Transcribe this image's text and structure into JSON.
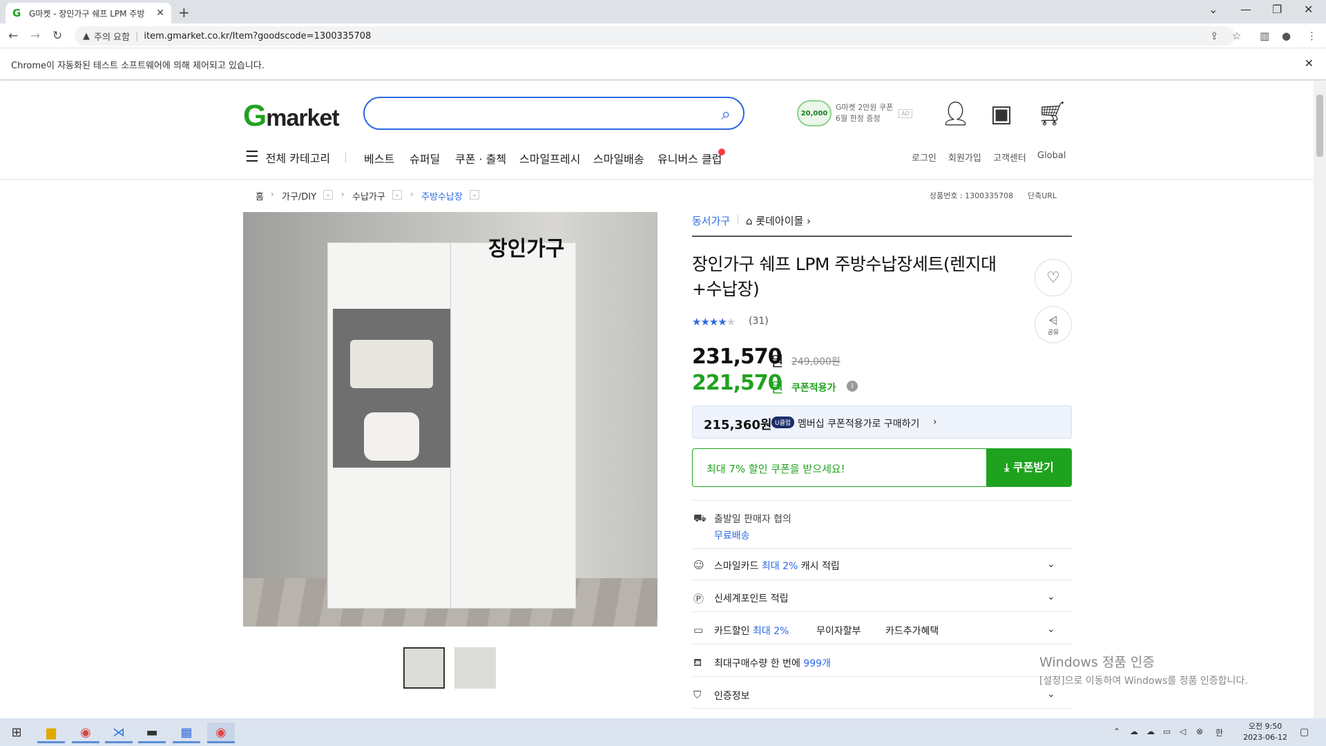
{
  "browser": {
    "tab_title": "G마켓 - 장인가구 쉐프 LPM 주방",
    "tab_favicon": "G",
    "new_tab": "+",
    "security_label": "주의 요함",
    "url": "item.gmarket.co.kr/Item?goodscode=1300335708",
    "infobar_text": "Chrome이 자동화된 테스트 소프트웨어에 의해 제어되고 있습니다."
  },
  "header": {
    "logo_g": "G",
    "logo_rest": "market",
    "promo_coin": "20,000",
    "promo_line1": "G마켓 2만원 쿠폰",
    "promo_line2": "6월 한정 증정",
    "promo_ad": "AD"
  },
  "nav": {
    "all_categories": "전체 카테고리",
    "links": [
      "베스트",
      "슈퍼딜",
      "쿠폰 · 출첵",
      "스마일프레시",
      "스마일배송",
      "유니버스 클럽"
    ],
    "utility": [
      "로그인",
      "회원가입",
      "고객센터",
      "Global"
    ]
  },
  "breadcrumb": {
    "items": [
      "홈",
      "가구/DIY",
      "수납가구",
      "주방수납장"
    ],
    "product_no": "상품번호 : 1300335708",
    "short_url": "단축URL"
  },
  "image": {
    "brand_text": "장인가구"
  },
  "product": {
    "seller": "동서가구",
    "store": "롯데아이몰",
    "title": "장인가구 쉐프 LPM 주방수납장세트(렌지대+수납장)",
    "review_count": "(31)",
    "rating": 4,
    "price": "231,570",
    "price_unit": "원",
    "original_price": "249,000원",
    "coupon_price": "221,570",
    "coupon_price_unit": "원",
    "coupon_label": "쿠폰적용가",
    "share_label": "공유",
    "member_price": "215,360원",
    "member_badge": "U클럽",
    "member_text": "멤버십 쿠폰적용가로 구매하기",
    "coupon_banner": "최대 7% 할인 쿠폰을 받으세요!",
    "coupon_button": "쿠폰받기",
    "shipping_line": "출발일 판매자 협의",
    "shipping_free": "무료배송",
    "smilecard_pre": "스마일카드",
    "smilecard_hl": "최대 2%",
    "smilecard_post": "캐시 적립",
    "shinsegae": "신세계포인트 적립",
    "card_pre": "카드할인",
    "card_hl": "최대 2%",
    "card_install": "무이자할부",
    "card_extra": "카드추가혜택",
    "max_pre": "최대구매수량 한 번에",
    "max_hl": "999개",
    "cert": "인증정보"
  },
  "watermark": {
    "line1": "Windows 정품 인증",
    "line2": "[설정]으로 이동하여 Windows를 정품 인증합니다."
  },
  "taskbar": {
    "ime": "한",
    "time": "오전 9:50",
    "date": "2023-06-12"
  },
  "colors": {
    "brand_green": "#1fa31f",
    "accent_blue": "#2d6ae3"
  }
}
